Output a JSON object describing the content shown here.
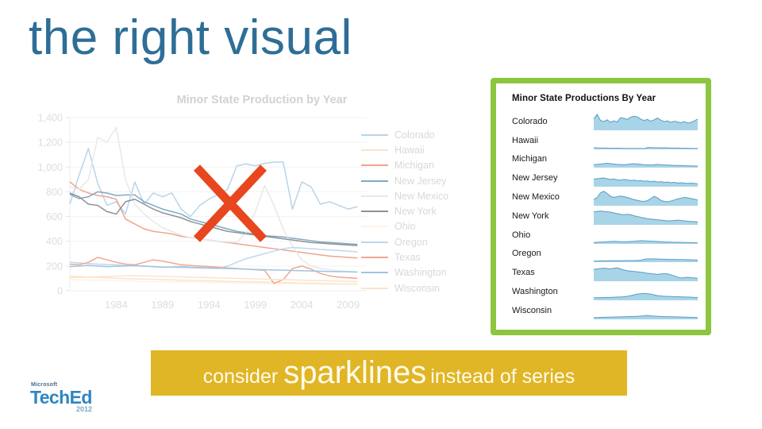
{
  "slide": {
    "title": "the right visual",
    "title_color": "#2E6E96",
    "background": "#ffffff"
  },
  "reject_marker": {
    "name": "red-x-mark",
    "color": "#E8461E"
  },
  "caption": {
    "before": "consider",
    "emphasis": "sparklines",
    "after": "instead of series",
    "banner_color": "#E0B526",
    "text_color": "#FFFBEA"
  },
  "logo": {
    "brand": "Microsoft",
    "product": "TechEd",
    "year": "2012",
    "color": "#2E86C1"
  },
  "line_chart": {
    "title": "Minor State Production by Year",
    "title_color": "#d2d2d2",
    "legend": [
      {
        "label": "Colorado",
        "color": "#b8d4ea"
      },
      {
        "label": "Hawaii",
        "color": "#fae3cf"
      },
      {
        "label": "Michigan",
        "color": "#f0a48c"
      },
      {
        "label": "New Jersey",
        "color": "#7fa9c4"
      },
      {
        "label": "New Mexico",
        "color": "#e8e8e8"
      },
      {
        "label": "New York",
        "color": "#8e9296"
      },
      {
        "label": "Ohio",
        "color": "#fcf3e0"
      },
      {
        "label": "Oregon",
        "color": "#bcd9ef"
      },
      {
        "label": "Texas",
        "color": "#f2a68e"
      },
      {
        "label": "Washington",
        "color": "#9ec4e2"
      },
      {
        "label": "Wisconsin",
        "color": "#fbe3cc"
      }
    ]
  },
  "sparkline_panel": {
    "title": "Minor State Productions By Year",
    "border_color": "#8CC63E",
    "fill_color": "#A8D4E8",
    "line_color": "#5B9BC4",
    "rows": [
      "Colorado",
      "Hawaii",
      "Michigan",
      "New Jersey",
      "New Mexico",
      "New York",
      "Ohio",
      "Oregon",
      "Texas",
      "Washington",
      "Wisconsin"
    ]
  },
  "chart_data": {
    "type": "line",
    "title": "Minor State Production by Year",
    "xlabel": "",
    "ylabel": "",
    "xlim": [
      1979,
      2011
    ],
    "ylim": [
      0,
      1400
    ],
    "yticks": [
      "0",
      "200",
      "400",
      "600",
      "800",
      "1,000",
      "1,200",
      "1,400"
    ],
    "xticks": [
      "1984",
      "1989",
      "1994",
      "1999",
      "2004",
      "2009"
    ],
    "x": [
      1979,
      1980,
      1981,
      1982,
      1983,
      1984,
      1985,
      1986,
      1987,
      1988,
      1989,
      1990,
      1991,
      1992,
      1993,
      1994,
      1995,
      1996,
      1997,
      1998,
      1999,
      2000,
      2001,
      2002,
      2003,
      2004,
      2005,
      2006,
      2007,
      2008,
      2009,
      2010
    ],
    "grid": true,
    "legend_position": "right",
    "series": [
      {
        "name": "Colorado",
        "color": "#b8d4ea",
        "values": [
          700,
          935,
          1150,
          870,
          690,
          720,
          620,
          880,
          700,
          790,
          760,
          790,
          660,
          600,
          690,
          740,
          780,
          820,
          1010,
          1025,
          1010,
          1030,
          1040,
          1040,
          660,
          880,
          840,
          700,
          720,
          690,
          660,
          680
        ]
      },
      {
        "name": "Hawaii",
        "color": "#fae3cf",
        "values": [
          120,
          115,
          110,
          108,
          105,
          100,
          98,
          96,
          95,
          93,
          90,
          88,
          85,
          84,
          82,
          80,
          78,
          76,
          75,
          73,
          72,
          70,
          68,
          66,
          65,
          63,
          62,
          60,
          58,
          57,
          56,
          55
        ]
      },
      {
        "name": "Michigan",
        "color": "#f0a48c",
        "values": [
          880,
          820,
          790,
          770,
          760,
          740,
          580,
          540,
          500,
          480,
          470,
          460,
          440,
          430,
          420,
          410,
          400,
          390,
          380,
          370,
          360,
          350,
          340,
          330,
          320,
          310,
          300,
          290,
          280,
          275,
          270,
          265
        ]
      },
      {
        "name": "New Jersey",
        "color": "#7fa9c4",
        "values": [
          780,
          745,
          760,
          800,
          790,
          770,
          775,
          775,
          720,
          690,
          660,
          640,
          620,
          580,
          560,
          540,
          520,
          500,
          480,
          470,
          455,
          445,
          440,
          435,
          425,
          415,
          405,
          395,
          390,
          385,
          380,
          375
        ]
      },
      {
        "name": "New Mexico",
        "color": "#e8e8e8",
        "values": [
          840,
          820,
          900,
          1240,
          1200,
          1320,
          900,
          700,
          620,
          560,
          510,
          480,
          450,
          430,
          420,
          410,
          400,
          395,
          390,
          470,
          640,
          850,
          690,
          500,
          360,
          250,
          200,
          180,
          170,
          160,
          155,
          150
        ]
      },
      {
        "name": "New York",
        "color": "#8e9296",
        "values": [
          790,
          760,
          700,
          690,
          640,
          620,
          720,
          740,
          700,
          660,
          630,
          610,
          590,
          560,
          540,
          520,
          500,
          480,
          470,
          460,
          450,
          440,
          430,
          420,
          410,
          400,
          390,
          385,
          380,
          375,
          370,
          365
        ]
      },
      {
        "name": "Ohio",
        "color": "#fcf3e0",
        "values": [
          90,
          88,
          86,
          85,
          84,
          82,
          80,
          78,
          76,
          75,
          74,
          72,
          70,
          69,
          68,
          66,
          65,
          64,
          62,
          61,
          60,
          58,
          57,
          56,
          55,
          54,
          53,
          52,
          51,
          50,
          49,
          48
        ]
      },
      {
        "name": "Oregon",
        "color": "#bcd9ef",
        "values": [
          230,
          225,
          220,
          215,
          212,
          210,
          205,
          200,
          198,
          195,
          192,
          190,
          188,
          186,
          184,
          182,
          180,
          200,
          230,
          260,
          280,
          300,
          320,
          340,
          350,
          345,
          340,
          335,
          330,
          325,
          320,
          315
        ]
      },
      {
        "name": "Texas",
        "color": "#f2a68e",
        "values": [
          215,
          210,
          230,
          270,
          250,
          230,
          215,
          210,
          230,
          250,
          240,
          225,
          210,
          205,
          200,
          195,
          190,
          185,
          180,
          175,
          170,
          165,
          60,
          90,
          180,
          200,
          175,
          140,
          120,
          110,
          105,
          100
        ]
      },
      {
        "name": "Washington",
        "color": "#9ec4e2",
        "values": [
          195,
          200,
          205,
          200,
          195,
          198,
          200,
          205,
          200,
          195,
          190,
          192,
          195,
          190,
          188,
          185,
          182,
          180,
          178,
          175,
          172,
          170,
          168,
          166,
          164,
          162,
          160,
          158,
          156,
          155,
          154,
          152
        ]
      },
      {
        "name": "Wisconsin",
        "color": "#fbe3cc",
        "values": [
          105,
          108,
          110,
          112,
          115,
          118,
          120,
          122,
          120,
          118,
          116,
          114,
          112,
          110,
          108,
          106,
          104,
          102,
          100,
          98,
          96,
          94,
          92,
          90,
          88,
          86,
          84,
          82,
          80,
          78,
          76,
          74
        ]
      }
    ]
  },
  "spark_data": {
    "type": "area",
    "series": [
      {
        "name": "Colorado",
        "values": [
          62,
          88,
          55,
          48,
          58,
          44,
          52,
          46,
          70,
          66,
          60,
          72,
          78,
          74,
          62,
          54,
          60,
          50,
          58,
          68,
          56,
          48,
          52,
          44,
          50,
          46,
          42,
          48,
          40,
          44,
          52,
          62
        ]
      },
      {
        "name": "Hawaii",
        "values": [
          8,
          8,
          7,
          7,
          7,
          6,
          6,
          6,
          6,
          5,
          5,
          5,
          5,
          5,
          5,
          4,
          10,
          10,
          9,
          9,
          8,
          8,
          8,
          7,
          7,
          7,
          6,
          6,
          6,
          5,
          5,
          5
        ]
      },
      {
        "name": "Michigan",
        "values": [
          16,
          18,
          20,
          22,
          24,
          22,
          20,
          18,
          17,
          16,
          18,
          20,
          22,
          20,
          18,
          16,
          15,
          14,
          16,
          18,
          16,
          15,
          14,
          13,
          12,
          12,
          11,
          11,
          10,
          10,
          9,
          9
        ]
      },
      {
        "name": "New Jersey",
        "values": [
          42,
          44,
          46,
          48,
          44,
          40,
          42,
          38,
          36,
          40,
          38,
          34,
          36,
          32,
          34,
          30,
          32,
          28,
          30,
          26,
          28,
          24,
          26,
          22,
          24,
          20,
          22,
          20,
          18,
          20,
          18,
          16
        ]
      },
      {
        "name": "New Mexico",
        "values": [
          36,
          44,
          72,
          80,
          68,
          52,
          46,
          50,
          54,
          50,
          46,
          40,
          34,
          30,
          26,
          24,
          28,
          40,
          52,
          44,
          30,
          24,
          22,
          26,
          32,
          38,
          42,
          46,
          44,
          40,
          36,
          32
        ]
      },
      {
        "name": "New York",
        "values": [
          72,
          74,
          76,
          74,
          72,
          70,
          66,
          62,
          58,
          56,
          58,
          56,
          50,
          46,
          42,
          38,
          34,
          32,
          30,
          28,
          26,
          24,
          22,
          22,
          24,
          26,
          24,
          22,
          20,
          18,
          18,
          16
        ]
      },
      {
        "name": "Ohio",
        "values": [
          8,
          9,
          10,
          11,
          12,
          13,
          14,
          13,
          12,
          11,
          12,
          13,
          14,
          16,
          18,
          17,
          16,
          15,
          14,
          13,
          12,
          11,
          10,
          10,
          9,
          9,
          8,
          8,
          7,
          7,
          6,
          6
        ]
      },
      {
        "name": "Oregon",
        "values": [
          6,
          6,
          7,
          7,
          7,
          8,
          8,
          8,
          8,
          8,
          9,
          9,
          9,
          10,
          10,
          16,
          18,
          18,
          18,
          17,
          17,
          16,
          16,
          15,
          15,
          14,
          14,
          14,
          13,
          13,
          12,
          12
        ]
      },
      {
        "name": "Texas",
        "values": [
          66,
          68,
          70,
          72,
          70,
          68,
          72,
          74,
          68,
          62,
          58,
          56,
          54,
          52,
          50,
          48,
          44,
          42,
          40,
          38,
          40,
          42,
          40,
          36,
          30,
          22,
          18,
          20,
          22,
          20,
          18,
          16
        ]
      },
      {
        "name": "Washington",
        "values": [
          14,
          14,
          15,
          15,
          16,
          16,
          17,
          18,
          18,
          20,
          22,
          26,
          30,
          34,
          36,
          38,
          36,
          34,
          30,
          26,
          24,
          22,
          22,
          21,
          20,
          20,
          19,
          18,
          18,
          17,
          16,
          16
        ]
      },
      {
        "name": "Wisconsin",
        "values": [
          10,
          10,
          11,
          11,
          12,
          12,
          13,
          13,
          14,
          14,
          15,
          16,
          16,
          17,
          18,
          20,
          22,
          20,
          18,
          17,
          16,
          15,
          15,
          14,
          14,
          13,
          13,
          12,
          12,
          11,
          11,
          10
        ]
      }
    ]
  }
}
